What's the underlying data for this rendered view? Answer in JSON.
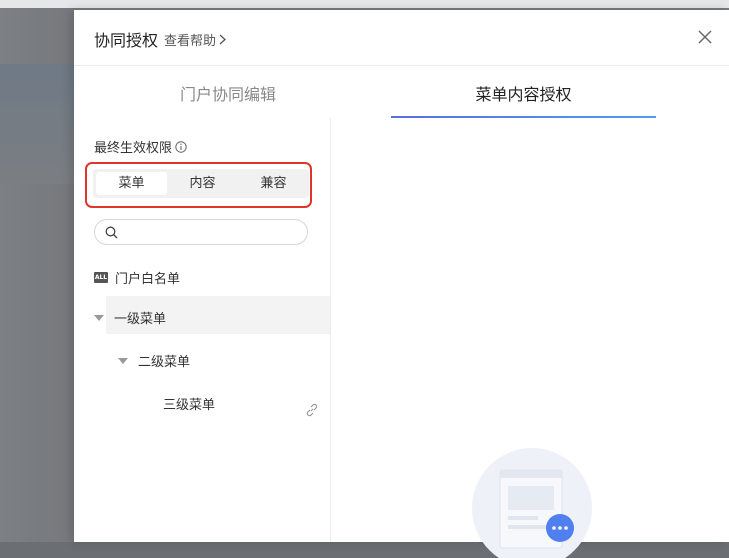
{
  "dialog": {
    "title": "协同授权",
    "help_label": "查看帮助"
  },
  "tabs": [
    {
      "label": "门户协同编辑",
      "active": false
    },
    {
      "label": "菜单内容授权",
      "active": true
    }
  ],
  "left_panel": {
    "permission_label": "最终生效权限",
    "segments": [
      "菜单",
      "内容",
      "兼容"
    ],
    "selected_segment": "菜单",
    "search": {
      "placeholder": "",
      "value": ""
    },
    "tree": {
      "whitelist": {
        "badge": "ALL",
        "label": "门户白名单"
      },
      "level1": {
        "label": "一级菜单",
        "expanded": true
      },
      "level2": {
        "label": "二级菜单",
        "expanded": true
      },
      "level3": {
        "label": "三级菜单"
      }
    }
  },
  "colors": {
    "accent_gradient_start": "#5a6fe0",
    "accent_gradient_end": "#4f9cf0",
    "highlight_box": "#e0352b"
  }
}
